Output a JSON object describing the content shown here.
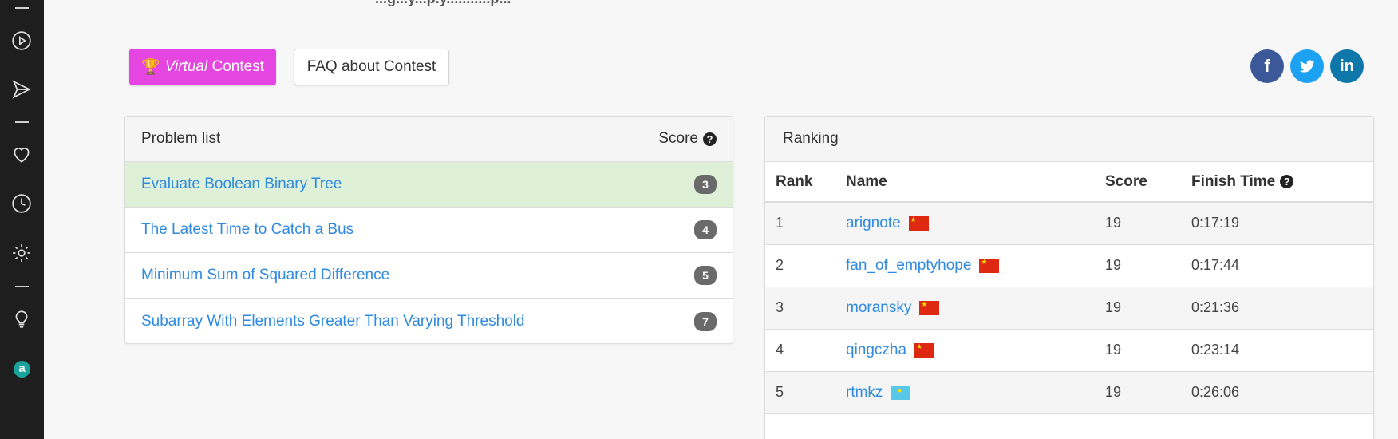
{
  "top_text": "...g...y...p.y...........p...",
  "buttons": {
    "virtual_prefix": "Virtual",
    "virtual_suffix": " Contest",
    "faq": "FAQ about Contest"
  },
  "social": {
    "facebook": "f",
    "twitter": "t",
    "linkedin": "in"
  },
  "problem_list": {
    "title": "Problem list",
    "score_label": "Score",
    "help_icon": "?",
    "items": [
      {
        "name": "Evaluate Boolean Binary Tree",
        "score": "3",
        "solved": true
      },
      {
        "name": "The Latest Time to Catch a Bus",
        "score": "4",
        "solved": false
      },
      {
        "name": "Minimum Sum of Squared Difference",
        "score": "5",
        "solved": false
      },
      {
        "name": "Subarray With Elements Greater Than Varying Threshold",
        "score": "7",
        "solved": false
      }
    ]
  },
  "ranking": {
    "title": "Ranking",
    "columns": [
      "Rank",
      "Name",
      "Score",
      "Finish Time"
    ],
    "help_icon": "?",
    "rows": [
      {
        "rank": "1",
        "name": "arignote",
        "flag": "cn",
        "score": "19",
        "time": "0:17:19"
      },
      {
        "rank": "2",
        "name": "fan_of_emptyhope",
        "flag": "cn",
        "score": "19",
        "time": "0:17:44"
      },
      {
        "rank": "3",
        "name": "moransky",
        "flag": "cn",
        "score": "19",
        "time": "0:21:36"
      },
      {
        "rank": "4",
        "name": "qingczha",
        "flag": "cn",
        "score": "19",
        "time": "0:23:14"
      },
      {
        "rank": "5",
        "name": "rtmkz",
        "flag": "kz",
        "score": "19",
        "time": "0:26:06"
      }
    ]
  },
  "sidebar": {
    "logo": "a",
    "icons": [
      "play-circle-icon",
      "send-icon",
      "heart-icon",
      "clock-icon",
      "gear-icon",
      "lightbulb-icon"
    ]
  },
  "colors": {
    "accent": "#e545e1",
    "link": "#2f8ae0",
    "solved_row": "#dff0d8"
  }
}
